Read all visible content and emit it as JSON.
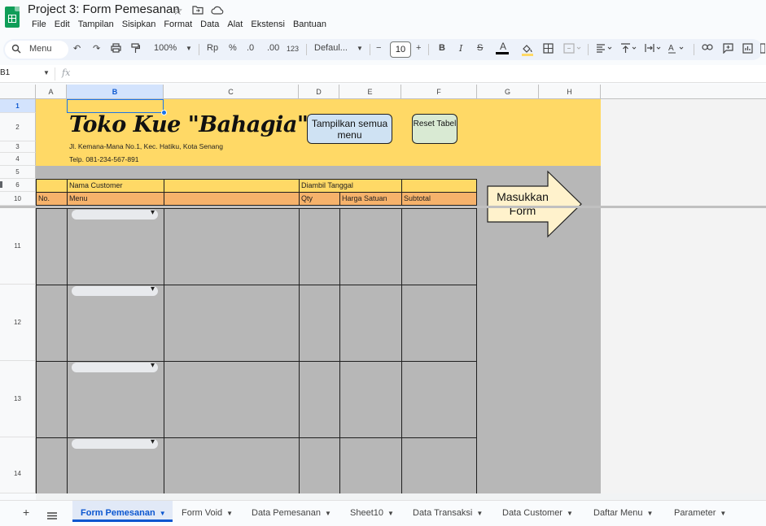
{
  "app": {
    "doc_title": "Project 3: Form Pemesanan",
    "menu": [
      "File",
      "Edit",
      "Tampilan",
      "Sisipkan",
      "Format",
      "Data",
      "Alat",
      "Ekstensi",
      "Bantuan"
    ]
  },
  "toolbar": {
    "menu_search_label": "Menu",
    "zoom": "100%",
    "currency": "Rp",
    "percent": "%",
    "dec_decrease": ".0",
    "dec_increase": ".00",
    "number_format": "123",
    "font_family": "Defaul...",
    "font_size": "10"
  },
  "formula_bar": {
    "cell_ref": "B1",
    "fx": "fx",
    "content": ""
  },
  "columns": [
    "A",
    "B",
    "C",
    "D",
    "E",
    "F",
    "G",
    "H"
  ],
  "rows": [
    "1",
    "2",
    "3",
    "4",
    "5",
    "6",
    "10",
    "11",
    "12",
    "13",
    "14"
  ],
  "sheet": {
    "shop_title": "Toko Kue \"Bahagia\"",
    "shop_address": "Jl. Kemana-Mana No.1, Kec. Hatiku, Kota Senang",
    "shop_phone": "Telp. 081-234-567-891",
    "button_show_all": "Tampilkan semua menu",
    "button_reset": "Reset Tabel",
    "arrow_label": "Masukkan Form",
    "label_customer": "Nama Customer",
    "label_taken_date": "Diambil Tanggal",
    "header_no": "No.",
    "header_menu": "Menu",
    "header_qty": "Qty",
    "header_unit_price": "Harga Satuan",
    "header_subtotal": "Subtotal"
  },
  "tabs": [
    {
      "label": "Form Pemesanan",
      "active": true
    },
    {
      "label": "Form Void"
    },
    {
      "label": "Data Pemesanan"
    },
    {
      "label": "Sheet10"
    },
    {
      "label": "Data Transaksi"
    },
    {
      "label": "Data Customer"
    },
    {
      "label": "Daftar Menu"
    },
    {
      "label": "Parameter"
    }
  ],
  "colors": {
    "yellow_fill": "#ffd966",
    "orange_fill": "#f6b26b",
    "gray_fill": "#b7b7b7",
    "blue_button": "#cfe2f3",
    "green_button": "#d9ead3",
    "arrow_fill": "#fff2cc"
  }
}
